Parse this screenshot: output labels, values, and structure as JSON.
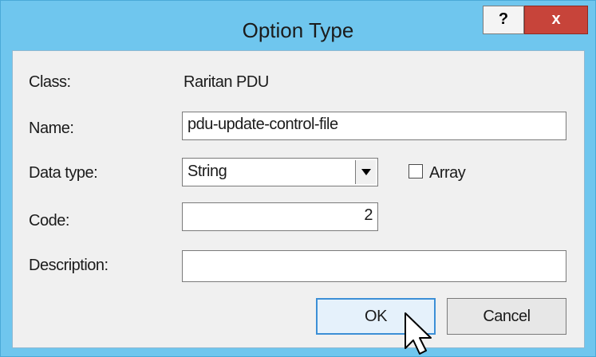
{
  "window": {
    "title": "Option Type",
    "help_button": "?",
    "close_button": "x"
  },
  "form": {
    "class_label": "Class:",
    "class_value": "Raritan PDU",
    "name_label": "Name:",
    "name_value": "pdu-update-control-file",
    "data_type_label": "Data type:",
    "data_type_value": "String",
    "array_label": "Array",
    "array_checked": false,
    "code_label": "Code:",
    "code_value": "2",
    "description_label": "Description:",
    "description_value": ""
  },
  "buttons": {
    "ok": "OK",
    "cancel": "Cancel"
  },
  "icons": {
    "dropdown": "chevron-down-icon",
    "cursor": "mouse-pointer-icon"
  },
  "colors": {
    "frame": "#6fc6ee",
    "close": "#c7443a",
    "client_bg": "#f0f0f0"
  }
}
